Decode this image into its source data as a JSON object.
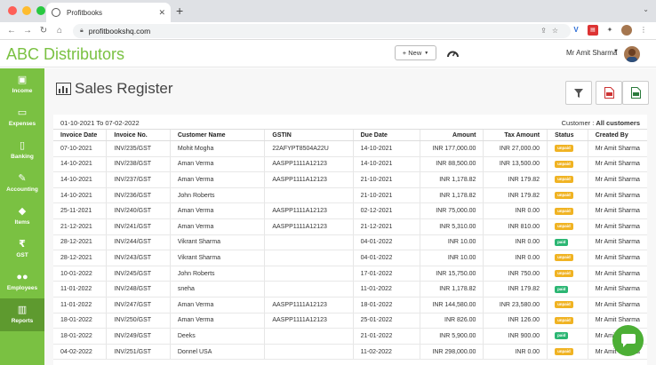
{
  "browser": {
    "tab_title": "Profitbooks",
    "url": "profitbookshq.com"
  },
  "header": {
    "brand": "ABC Distributors",
    "new_button": "+ New",
    "user_name": "Mr Amit Sharma"
  },
  "sidebar": {
    "items": [
      {
        "label": "Income",
        "icon": "income-icon"
      },
      {
        "label": "Expenses",
        "icon": "expenses-icon"
      },
      {
        "label": "Banking",
        "icon": "banking-icon"
      },
      {
        "label": "Accounting",
        "icon": "accounting-icon"
      },
      {
        "label": "Items",
        "icon": "items-icon"
      },
      {
        "label": "GST",
        "icon": "rupee-icon"
      },
      {
        "label": "Employees",
        "icon": "employees-icon"
      },
      {
        "label": "Reports",
        "icon": "reports-icon",
        "active": true
      }
    ]
  },
  "page": {
    "title": "Sales Register",
    "date_range": "01-10-2021 To 07-02-2022",
    "customer_label": "Customer :",
    "customer_value": "All customers"
  },
  "table": {
    "headers": [
      "Invoice Date",
      "Invoice No.",
      "Customer Name",
      "GSTIN",
      "Due Date",
      "Amount",
      "Tax Amount",
      "Status",
      "Created By"
    ],
    "rows": [
      [
        "07-10-2021",
        "INV/235/GST",
        "Mohit Mogha",
        "22AFYPT8504A22U",
        "14-10-2021",
        "INR 177,000.00",
        "INR 27,000.00",
        "unpaid",
        "Mr Amit Sharma"
      ],
      [
        "14-10-2021",
        "INV/238/GST",
        "Aman Verma",
        "AASPP1111A12123",
        "14-10-2021",
        "INR 88,500.00",
        "INR 13,500.00",
        "unpaid",
        "Mr Amit Sharma"
      ],
      [
        "14-10-2021",
        "INV/237/GST",
        "Aman Verma",
        "AASPP1111A12123",
        "21-10-2021",
        "INR 1,178.82",
        "INR 179.82",
        "unpaid",
        "Mr Amit Sharma"
      ],
      [
        "14-10-2021",
        "INV/236/GST",
        "John Roberts",
        "",
        "21-10-2021",
        "INR 1,178.82",
        "INR 179.82",
        "unpaid",
        "Mr Amit Sharma"
      ],
      [
        "25-11-2021",
        "INV/240/GST",
        "Aman Verma",
        "AASPP1111A12123",
        "02-12-2021",
        "INR 75,000.00",
        "INR 0.00",
        "unpaid",
        "Mr Amit Sharma"
      ],
      [
        "21-12-2021",
        "INV/241/GST",
        "Aman Verma",
        "AASPP1111A12123",
        "21-12-2021",
        "INR 5,310.00",
        "INR 810.00",
        "unpaid",
        "Mr Amit Sharma"
      ],
      [
        "28-12-2021",
        "INV/244/GST",
        "Vikrant Sharma",
        "",
        "04-01-2022",
        "INR 10.00",
        "INR 0.00",
        "paid",
        "Mr Amit Sharma"
      ],
      [
        "28-12-2021",
        "INV/243/GST",
        "Vikrant Sharma",
        "",
        "04-01-2022",
        "INR 10.00",
        "INR 0.00",
        "unpaid",
        "Mr Amit Sharma"
      ],
      [
        "10-01-2022",
        "INV/245/GST",
        "John Roberts",
        "",
        "17-01-2022",
        "INR 15,750.00",
        "INR 750.00",
        "unpaid",
        "Mr Amit Sharma"
      ],
      [
        "11-01-2022",
        "INV/248/GST",
        "sneha",
        "",
        "11-01-2022",
        "INR 1,178.82",
        "INR 179.82",
        "paid",
        "Mr Amit Sharma"
      ],
      [
        "11-01-2022",
        "INV/247/GST",
        "Aman Verma",
        "AASPP1111A12123",
        "18-01-2022",
        "INR 144,580.00",
        "INR 23,580.00",
        "unpaid",
        "Mr Amit Sharma"
      ],
      [
        "18-01-2022",
        "INV/250/GST",
        "Aman Verma",
        "AASPP1111A12123",
        "25-01-2022",
        "INR 826.00",
        "INR 126.00",
        "unpaid",
        "Mr Amit Sharma"
      ],
      [
        "18-01-2022",
        "INV/249/GST",
        "Deeks",
        "",
        "21-01-2022",
        "INR 5,900.00",
        "INR 900.00",
        "paid",
        "Mr Amit Sharma"
      ],
      [
        "04-02-2022",
        "INV/251/GST",
        "Donnel USA",
        "",
        "11-02-2022",
        "INR 298,000.00",
        "INR 0.00",
        "unpaid",
        "Mr Amit Sharma"
      ]
    ]
  },
  "colors": {
    "brand_green": "#7ac142",
    "unpaid": "#f0b323",
    "paid": "#2bb673"
  }
}
